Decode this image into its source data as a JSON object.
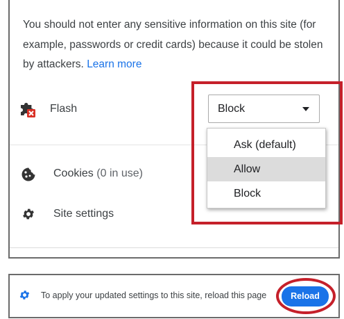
{
  "site_info": {
    "warning_text": "You should not enter any sensitive information on this site (for example, passwords or credit cards) because it could be stolen by attackers.",
    "learn_more": "Learn more"
  },
  "flash": {
    "label": "Flash",
    "icon": "puzzle-blocked-icon",
    "selected": "Block",
    "options": [
      "Ask (default)",
      "Allow",
      "Block"
    ],
    "highlighted_option": "Allow"
  },
  "cookies": {
    "label": "Cookies",
    "count": "(0 in use)",
    "icon": "cookie-icon"
  },
  "site_settings": {
    "label": "Site settings",
    "icon": "gear-icon"
  },
  "notice": {
    "icon": "gear-icon",
    "text": "To apply your updated settings to this site, reload this page",
    "reload_label": "Reload"
  },
  "colors": {
    "accent": "#1a73e8",
    "highlight_annotation": "#c5202a"
  }
}
